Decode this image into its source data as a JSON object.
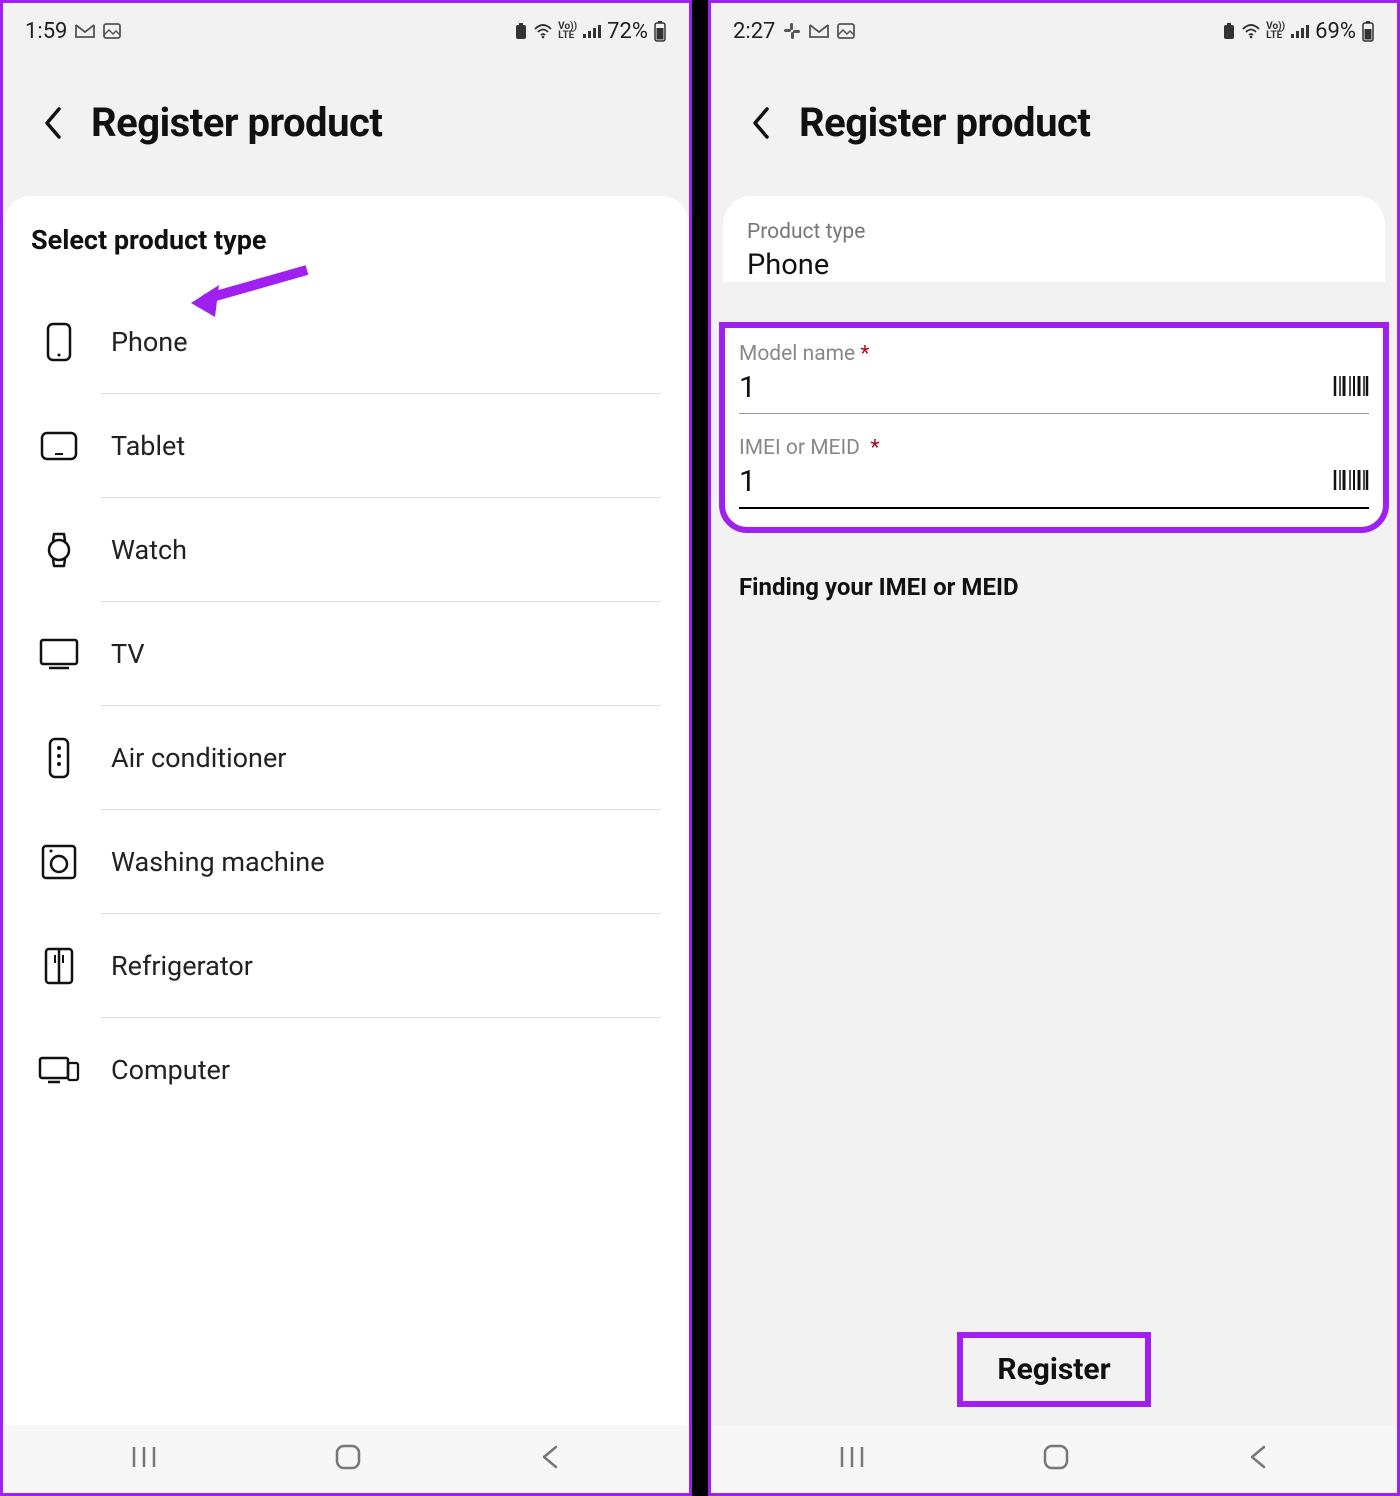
{
  "left": {
    "status": {
      "time": "1:59",
      "battery": "72%"
    },
    "header": {
      "title": "Register product"
    },
    "section_title": "Select product type",
    "items": [
      {
        "label": "Phone",
        "icon": "phone-icon"
      },
      {
        "label": "Tablet",
        "icon": "tablet-icon"
      },
      {
        "label": "Watch",
        "icon": "watch-icon"
      },
      {
        "label": "TV",
        "icon": "tv-icon"
      },
      {
        "label": "Air conditioner",
        "icon": "ac-remote-icon"
      },
      {
        "label": "Washing machine",
        "icon": "washing-machine-icon"
      },
      {
        "label": "Refrigerator",
        "icon": "refrigerator-icon"
      },
      {
        "label": "Computer",
        "icon": "computer-icon"
      }
    ],
    "annotation": {
      "arrow_points_to": "Phone",
      "color": "#a020f0"
    }
  },
  "right": {
    "status": {
      "time": "2:27",
      "battery": "69%"
    },
    "header": {
      "title": "Register product"
    },
    "product_type": {
      "label": "Product type",
      "value": "Phone"
    },
    "fields": {
      "model": {
        "label": "Model name",
        "required": true,
        "value": "1"
      },
      "imei": {
        "label": "IMEI or MEID",
        "required": true,
        "value": "1"
      }
    },
    "find_link": "Finding your IMEI or MEID",
    "register_button": "Register",
    "annotation": {
      "highlight_boxes": [
        "model+imei fields",
        "Register button"
      ],
      "color": "#a020f0"
    }
  }
}
